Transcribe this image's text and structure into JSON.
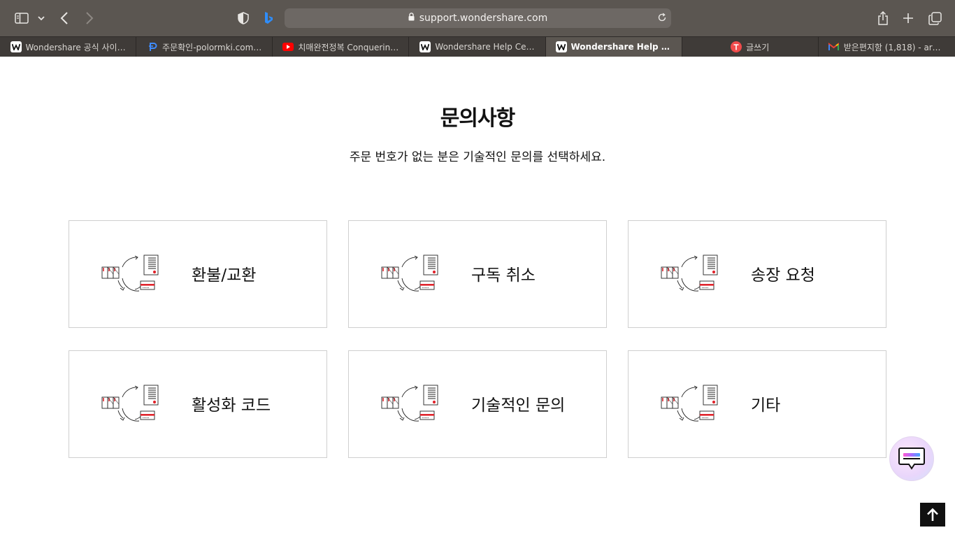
{
  "browser": {
    "url": "support.wondershare.com",
    "tabs": [
      {
        "label": "Wondershare 공식 사이…",
        "favicon": "wondershare-icon",
        "active": false
      },
      {
        "label": "주문확인-polormki.com…",
        "favicon": "polormki-icon",
        "active": false
      },
      {
        "label": "치매완전정복 Conquerin…",
        "favicon": "youtube-icon",
        "active": false
      },
      {
        "label": "Wondershare Help Ce…",
        "favicon": "wondershare-icon",
        "active": false
      },
      {
        "label": "Wondershare Help Ce…",
        "favicon": "wondershare-icon",
        "active": true
      },
      {
        "label": "글쓰기",
        "favicon": "tistory-icon",
        "active": false
      },
      {
        "label": "받은편지함 (1,818) - arm…",
        "favicon": "gmail-icon",
        "active": false
      }
    ]
  },
  "page": {
    "title": "문의사항",
    "subtitle": "주문 번호가 없는 분은 기술적인 문의를 선택하세요.",
    "cards": [
      {
        "label": "환불/교환"
      },
      {
        "label": "구독 취소"
      },
      {
        "label": "송장 요청"
      },
      {
        "label": "활성화 코드"
      },
      {
        "label": "기술적인 문의"
      },
      {
        "label": "기타"
      }
    ]
  },
  "colors": {
    "toolbar": "#5b5651",
    "tab_strip": "#3f3b38",
    "accent_red": "#e0242c",
    "text": "#111111"
  }
}
